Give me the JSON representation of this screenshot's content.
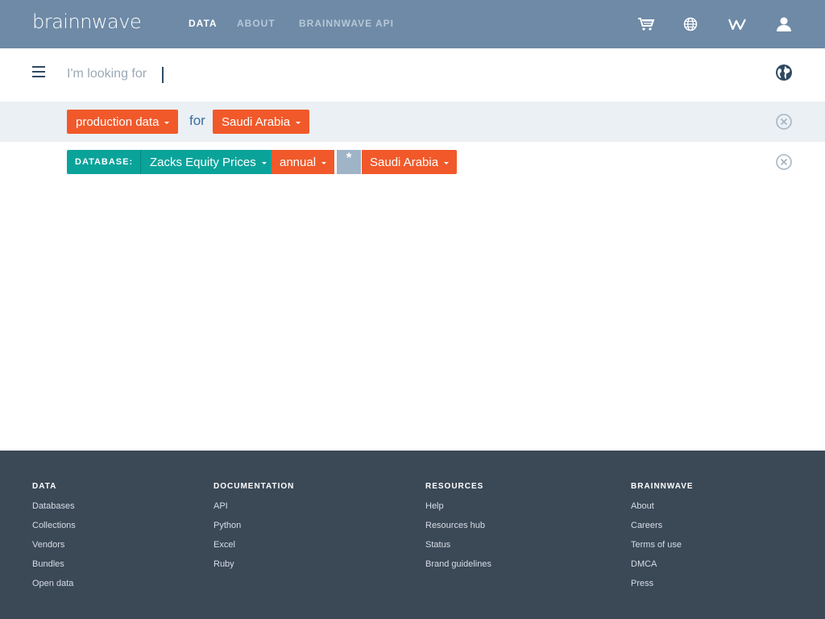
{
  "header": {
    "logo_text": "brainnwave",
    "nav": [
      {
        "label": "DATA",
        "active": true
      },
      {
        "label": "ABOUT",
        "active": false
      },
      {
        "label": "BRAINNWAVE API",
        "active": false
      }
    ],
    "icons": [
      "cart-icon",
      "globe-icon",
      "brand-w-icon",
      "user-icon"
    ]
  },
  "search": {
    "placeholder": "I'm looking for",
    "value": ""
  },
  "query": {
    "subject": "production data",
    "connector": "for",
    "region": "Saudi Arabia"
  },
  "filter": {
    "database_label": "DATABASE:",
    "database": "Zacks Equity Prices",
    "frequency": "annual",
    "wildcard": "*",
    "region": "Saudi Arabia"
  },
  "footer": {
    "columns": [
      {
        "heading": "DATA",
        "links": [
          "Databases",
          "Collections",
          "Vendors",
          "Bundles",
          "Open data"
        ]
      },
      {
        "heading": "DOCUMENTATION",
        "links": [
          "API",
          "Python",
          "Excel",
          "Ruby"
        ]
      },
      {
        "heading": "RESOURCES",
        "links": [
          "Help",
          "Resources hub",
          "Status",
          "Brand guidelines"
        ]
      },
      {
        "heading": "BRAINNWAVE",
        "links": [
          "About",
          "Careers",
          "Terms of use",
          "DMCA",
          "Press"
        ]
      }
    ]
  },
  "colors": {
    "header_bg": "#6e8aa6",
    "accent_orange": "#f1592a",
    "accent_teal": "#0aa39a",
    "footer_bg": "#3b4856"
  }
}
